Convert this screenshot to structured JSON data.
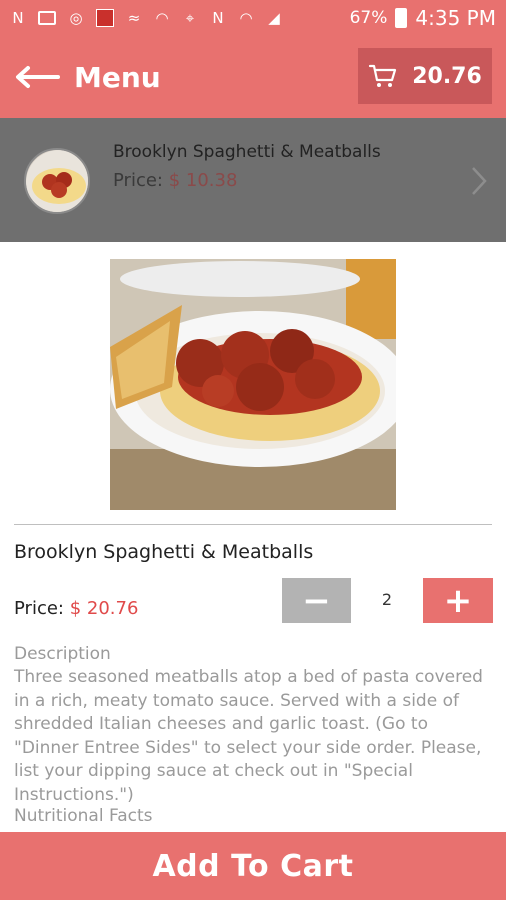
{
  "status_bar": {
    "battery": "67%",
    "time": "4:35 PM",
    "icons": [
      "notification-n-icon",
      "mail-icon",
      "voicemail-icon",
      "app-notification-icon",
      "signal-app-icon",
      "wifi-calling-icon",
      "location-icon",
      "nfc-icon",
      "wifi-icon",
      "cell-signal-icon",
      "battery-icon"
    ]
  },
  "header": {
    "back_label": "Menu",
    "cart_total": "20.76"
  },
  "selected_item": {
    "name": "Brooklyn Spaghetti & Meatballs",
    "price_label": "Price:",
    "price": "$ 10.38"
  },
  "detail": {
    "name": "Brooklyn Spaghetti & Meatballs",
    "price_label": "Price:",
    "price": "$ 20.76",
    "quantity": "2",
    "minus": "−",
    "plus": "+",
    "description_label": "Description",
    "description": "Three seasoned meatballs atop a bed of pasta covered in a rich, meaty tomato sauce. Served with a side of shredded Italian cheeses and garlic toast. (Go to \"Dinner Entree Sides\" to select your side order. Please, list your dipping sauce at check out in \"Special Instructions.\")",
    "nutrition_label": "Nutritional Facts"
  },
  "footer": {
    "add_to_cart": "Add To Cart"
  },
  "colors": {
    "brand": "#e8716f",
    "cart_button": "#c9585a",
    "banner": "#6f6f6f",
    "price_red": "#e04a4a",
    "minus_gray": "#b3b3b3"
  }
}
